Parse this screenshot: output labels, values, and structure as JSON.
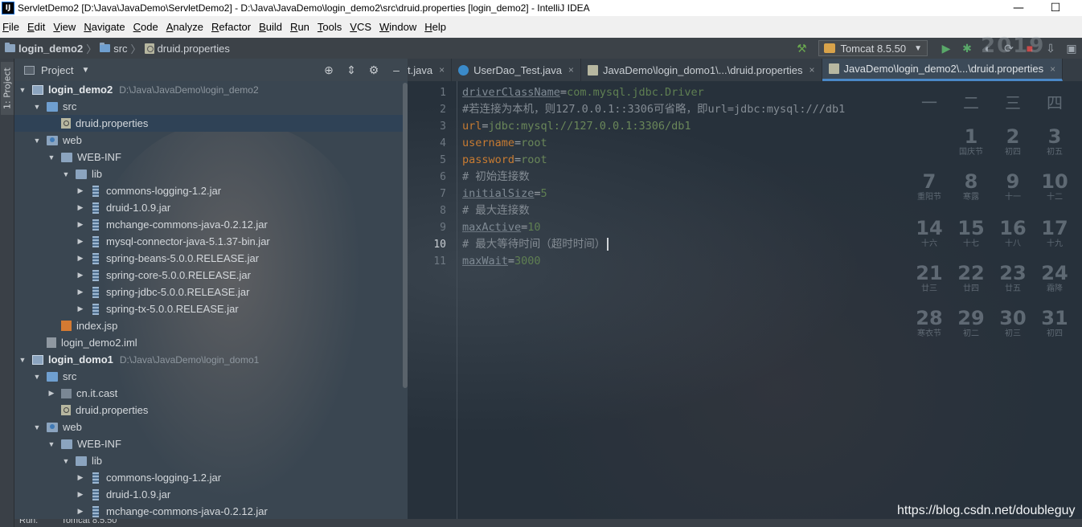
{
  "window": {
    "title": "ServletDemo2 [D:\\Java\\JavaDemo\\ServletDemo2] - D:\\Java\\JavaDemo\\login_demo2\\src\\druid.properties [login_demo2] - IntelliJ IDEA",
    "app_icon": "IJ"
  },
  "menu": [
    "File",
    "Edit",
    "View",
    "Navigate",
    "Code",
    "Analyze",
    "Refactor",
    "Build",
    "Run",
    "Tools",
    "VCS",
    "Window",
    "Help"
  ],
  "breadcrumb": {
    "project": "login_demo2",
    "folder": "src",
    "file": "druid.properties"
  },
  "run_config": {
    "label": "Tomcat 8.5.50"
  },
  "left_stripe": {
    "tab": "1: Project"
  },
  "project_panel": {
    "title": "Project",
    "tree": [
      {
        "label": "login_demo2",
        "path": "D:\\Java\\JavaDemo\\login_demo2"
      },
      {
        "label": "src"
      },
      {
        "label": "druid.properties"
      },
      {
        "label": "web"
      },
      {
        "label": "WEB-INF"
      },
      {
        "label": "lib"
      },
      {
        "label": "commons-logging-1.2.jar"
      },
      {
        "label": "druid-1.0.9.jar"
      },
      {
        "label": "mchange-commons-java-0.2.12.jar"
      },
      {
        "label": "mysql-connector-java-5.1.37-bin.jar"
      },
      {
        "label": "spring-beans-5.0.0.RELEASE.jar"
      },
      {
        "label": "spring-core-5.0.0.RELEASE.jar"
      },
      {
        "label": "spring-jdbc-5.0.0.RELEASE.jar"
      },
      {
        "label": "spring-tx-5.0.0.RELEASE.jar"
      },
      {
        "label": "index.jsp"
      },
      {
        "label": "login_demo2.iml"
      },
      {
        "label": "login_domo1",
        "path": "D:\\Java\\JavaDemo\\login_domo1"
      },
      {
        "label": "src"
      },
      {
        "label": "cn.it.cast"
      },
      {
        "label": "druid.properties"
      },
      {
        "label": "web"
      },
      {
        "label": "WEB-INF"
      },
      {
        "label": "lib"
      },
      {
        "label": "commons-logging-1.2.jar"
      },
      {
        "label": "druid-1.0.9.jar"
      },
      {
        "label": "mchange-commons-java-0.2.12.jar"
      }
    ]
  },
  "tabs": [
    {
      "label": "t.java"
    },
    {
      "label": "UserDao_Test.java"
    },
    {
      "label": "JavaDemo\\login_domo1\\...\\druid.properties"
    },
    {
      "label": "JavaDemo\\login_demo2\\...\\druid.properties"
    }
  ],
  "editor": {
    "current_line": 10,
    "lines": [
      {
        "num": "1",
        "key": "driverClassName",
        "value": "com.mysql.jdbc.Driver"
      },
      {
        "num": "2",
        "comment": "#若连接为本机，则127.0.0.1::3306可省略，即url=jdbc:mysql:///db1"
      },
      {
        "num": "3",
        "key": "url",
        "value": "jdbc:mysql://127.0.0.1:3306/db1"
      },
      {
        "num": "4",
        "key": "username",
        "value": "root"
      },
      {
        "num": "5",
        "key": "password",
        "value": "root"
      },
      {
        "num": "6",
        "comment": "# 初始连接数"
      },
      {
        "num": "7",
        "key": "initialSize",
        "value": "5"
      },
      {
        "num": "8",
        "comment": "# 最大连接数"
      },
      {
        "num": "9",
        "key": "maxActive",
        "value": "10"
      },
      {
        "num": "10",
        "comment": "# 最大等待时间（超时时间）"
      },
      {
        "num": "11",
        "key": "maxWait",
        "value": "3000"
      }
    ]
  },
  "calendar": {
    "year": "2019",
    "weekdays": [
      "一",
      "二",
      "三",
      "四"
    ],
    "weeks": [
      [
        {
          "d": "",
          "s": ""
        },
        {
          "d": "1",
          "s": "国庆节"
        },
        {
          "d": "2",
          "s": "初四"
        },
        {
          "d": "3",
          "s": "初五"
        }
      ],
      [
        {
          "d": "7",
          "s": "重阳节"
        },
        {
          "d": "8",
          "s": "寒露"
        },
        {
          "d": "9",
          "s": "十一"
        },
        {
          "d": "10",
          "s": "十二"
        }
      ],
      [
        {
          "d": "14",
          "s": "十六"
        },
        {
          "d": "15",
          "s": "十七"
        },
        {
          "d": "16",
          "s": "十八"
        },
        {
          "d": "17",
          "s": "十九"
        }
      ],
      [
        {
          "d": "21",
          "s": "廿三"
        },
        {
          "d": "22",
          "s": "廿四"
        },
        {
          "d": "23",
          "s": "廿五"
        },
        {
          "d": "24",
          "s": "霜降"
        }
      ],
      [
        {
          "d": "28",
          "s": "寒衣节"
        },
        {
          "d": "29",
          "s": "初二"
        },
        {
          "d": "30",
          "s": "初三"
        },
        {
          "d": "31",
          "s": "初四"
        }
      ]
    ]
  },
  "watermark": "https://blog.csdn.net/doubleguy",
  "bottom": {
    "run_label": "Run:",
    "run_config": "Tomcat 8.5.50"
  },
  "colors": {
    "key": "#c77b32",
    "value": "#6a8759",
    "comment": "#848c94",
    "selection": "#2f4256",
    "active_tab_underline": "#4a88c7"
  }
}
